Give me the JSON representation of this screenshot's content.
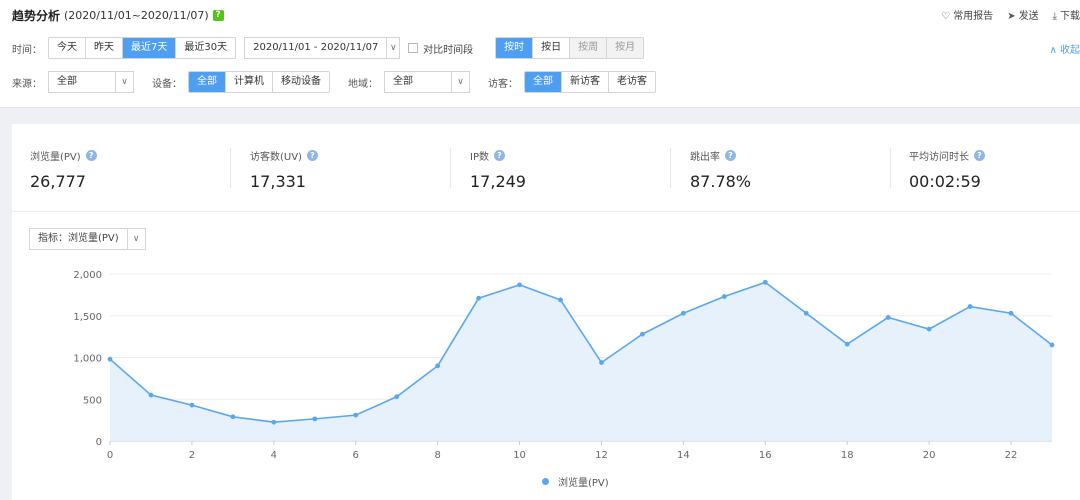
{
  "header": {
    "title": "趋势分析",
    "date_range": "(2020/11/01~2020/11/07)",
    "help_icon": "question-icon",
    "actions": [
      {
        "icon": "heart-icon",
        "label": "常用报告"
      },
      {
        "icon": "send-icon",
        "label": "发送"
      },
      {
        "icon": "download-icon",
        "label": "下载"
      }
    ]
  },
  "filters": {
    "time_label": "时间：",
    "time_options": [
      "今天",
      "昨天",
      "最近7天",
      "最近30天"
    ],
    "time_active": "最近7天",
    "date_picker_value": "2020/11/01 - 2020/11/07",
    "compare_label": "对比时间段",
    "granularity": [
      {
        "label": "按时",
        "state": "active"
      },
      {
        "label": "按日",
        "state": "normal"
      },
      {
        "label": "按周",
        "state": "disabled"
      },
      {
        "label": "按月",
        "state": "disabled"
      }
    ],
    "collapse_label": "收起",
    "source_label": "来源：",
    "source_value": "全部",
    "device_label": "设备：",
    "device_options": [
      "全部",
      "计算机",
      "移动设备"
    ],
    "device_active": "全部",
    "region_label": "地域：",
    "region_value": "全部",
    "visitor_label": "访客：",
    "visitor_options": [
      "全部",
      "新访客",
      "老访客"
    ],
    "visitor_active": "全部"
  },
  "metrics": [
    {
      "name": "浏览量(PV)",
      "value": "26,777"
    },
    {
      "name": "访客数(UV)",
      "value": "17,331"
    },
    {
      "name": "IP数",
      "value": "17,249"
    },
    {
      "name": "跳出率",
      "value": "87.78%"
    },
    {
      "name": "平均访问时长",
      "value": "00:02:59"
    }
  ],
  "indicator": {
    "label": "指标：",
    "value": "浏览量(PV)"
  },
  "colors": {
    "accent": "#4e9ff2",
    "line": "#5aa7ee",
    "area": "#e3effb"
  },
  "chart_data": {
    "type": "area",
    "x": [
      0,
      1,
      2,
      3,
      4,
      5,
      6,
      7,
      8,
      9,
      10,
      11,
      12,
      13,
      14,
      15,
      16,
      17,
      18,
      19,
      20,
      21,
      22,
      23
    ],
    "x_tick_labels": [
      "0",
      "2",
      "4",
      "6",
      "8",
      "10",
      "12",
      "14",
      "16",
      "18",
      "20",
      "22"
    ],
    "series": [
      {
        "name": "浏览量(PV)",
        "values": [
          980,
          550,
          430,
          290,
          225,
          265,
          310,
          530,
          900,
          1710,
          1870,
          1690,
          940,
          1280,
          1530,
          1730,
          1900,
          1530,
          1160,
          1480,
          1340,
          1610,
          1530,
          1150
        ]
      }
    ],
    "y_ticks": [
      "0",
      "500",
      "1,000",
      "1,500",
      "2,000"
    ],
    "ylim": [
      0,
      2000
    ],
    "grid": true,
    "legend": "bottom-center"
  }
}
